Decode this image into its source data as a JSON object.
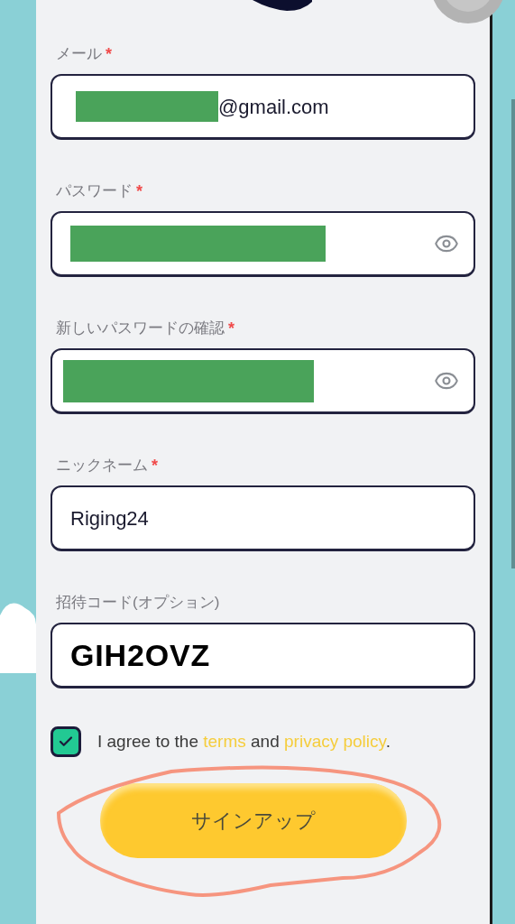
{
  "fields": [
    {
      "kind": "email",
      "label": "メール",
      "required_mark": "*",
      "value": "@gmail.com",
      "redacted": true
    },
    {
      "kind": "password",
      "label": "パスワード",
      "required_mark": "*",
      "redacted": true
    },
    {
      "kind": "password",
      "label": "新しいパスワードの確認",
      "required_mark": "*",
      "redacted": true
    },
    {
      "kind": "text",
      "label": "ニックネーム",
      "required_mark": "*",
      "value": "Riging24"
    },
    {
      "kind": "code",
      "label": "招待コード(オプション)",
      "value": "GIH2OVZ"
    }
  ],
  "agreement": {
    "checked": true,
    "text": "I agree to the",
    "terms_link": "terms",
    "middle": "and",
    "privacy_link": "privacy policy",
    "end": "."
  },
  "submit_button": "サインアップ"
}
